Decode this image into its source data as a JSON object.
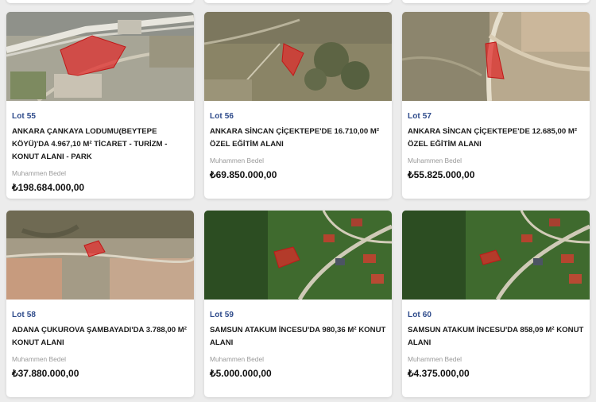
{
  "listings": [
    {
      "lot": "Lot 55",
      "title": "ANKARA ÇANKAYA LODUMU(BEYTEPE KÖYÜ)'DA 4.967,10 M² TİCARET - TURİZM - KONUT ALANI - PARK",
      "price_label": "Muhammen Bedel",
      "price": "₺198.684.000,00"
    },
    {
      "lot": "Lot 56",
      "title": "ANKARA SİNCAN ÇİÇEKTEPE'DE 16.710,00 M² ÖZEL EĞİTİM ALANI",
      "price_label": "Muhammen Bedel",
      "price": "₺69.850.000,00"
    },
    {
      "lot": "Lot 57",
      "title": "ANKARA SİNCAN ÇİÇEKTEPE'DE 12.685,00 M² ÖZEL EĞİTİM ALANI",
      "price_label": "Muhammen Bedel",
      "price": "₺55.825.000,00"
    },
    {
      "lot": "Lot 58",
      "title": "ADANA ÇUKUROVA ŞAMBAYADI'DA 3.788,00 M² KONUT ALANI",
      "price_label": "Muhammen Bedel",
      "price": "₺37.880.000,00"
    },
    {
      "lot": "Lot 59",
      "title": "SAMSUN ATAKUM İNCESU'DA 980,36 M² KONUT ALANI",
      "price_label": "Muhammen Bedel",
      "price": "₺5.000.000,00"
    },
    {
      "lot": "Lot 60",
      "title": "SAMSUN ATAKUM İNCESU'DA 858,09 M² KONUT ALANI",
      "price_label": "Muhammen Bedel",
      "price": "₺4.375.000,00"
    }
  ],
  "colors": {
    "lot_text": "#2d4a8a",
    "parcel_highlight": "#e02a2a",
    "background": "#ececec"
  }
}
